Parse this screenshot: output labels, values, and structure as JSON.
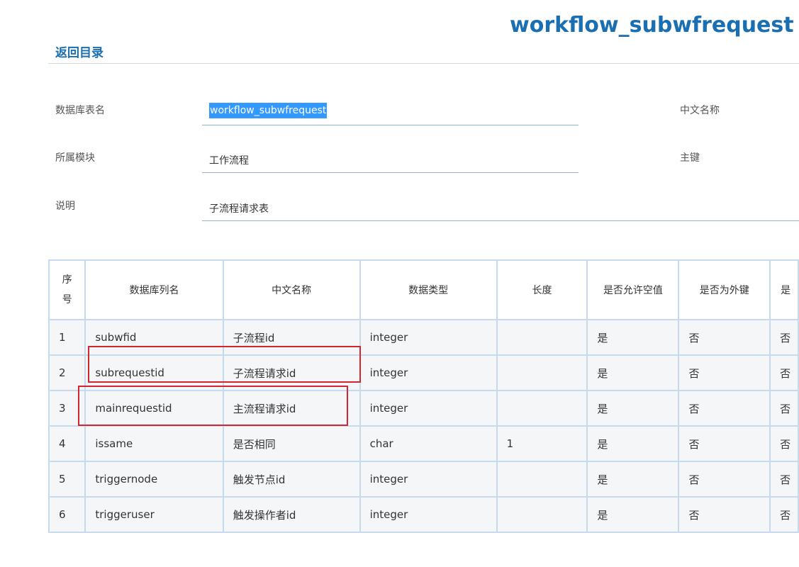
{
  "header": {
    "title": "workflow_subwfrequest",
    "back_link": "返回目录"
  },
  "form": {
    "table_name_label": "数据库表名",
    "table_name_value": "workflow_subwfrequest",
    "cn_name_label": "中文名称",
    "module_label": "所属模块",
    "module_value": "工作流程",
    "primary_key_label": "主键",
    "desc_label": "说明",
    "desc_value": "子流程请求表"
  },
  "table": {
    "headers": [
      "序号",
      "数据库列名",
      "中文名称",
      "数据类型",
      "长度",
      "是否允许空值",
      "是否为外键",
      "是"
    ],
    "rows": [
      [
        "1",
        "subwfid",
        "子流程id",
        "integer",
        "",
        "是",
        "否",
        "否"
      ],
      [
        "2",
        "subrequestid",
        "子流程请求id",
        "integer",
        "",
        "是",
        "否",
        "否"
      ],
      [
        "3",
        "mainrequestid",
        "主流程请求id",
        "integer",
        "",
        "是",
        "否",
        "否"
      ],
      [
        "4",
        "issame",
        "是否相同",
        "char",
        "1",
        "是",
        "否",
        "否"
      ],
      [
        "5",
        "triggernode",
        "触发节点id",
        "integer",
        "",
        "是",
        "否",
        "否"
      ],
      [
        "6",
        "triggeruser",
        "触发操作者id",
        "integer",
        "",
        "是",
        "否",
        "否"
      ]
    ]
  },
  "colors": {
    "accent": "#1a6fb3",
    "selection": "#3399ff",
    "highlight_box": "#d22630",
    "table_border": "#c5daee"
  }
}
